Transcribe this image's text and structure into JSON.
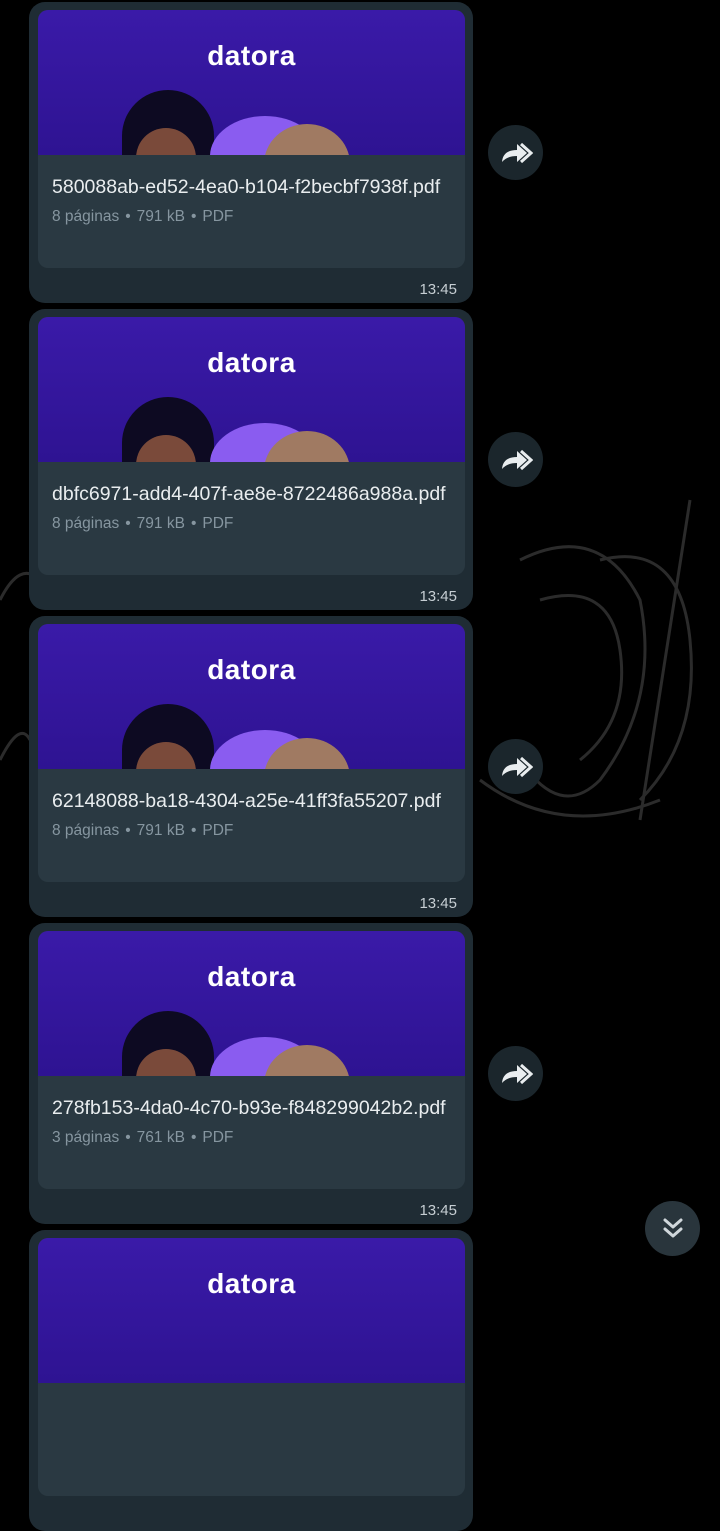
{
  "messages": [
    {
      "brand": "datora",
      "file_name": "580088ab-ed52-4ea0-b104-f2becbf7938f.pdf",
      "pages": "8 páginas",
      "size": "791 kB",
      "type": "PDF",
      "time": "13:45"
    },
    {
      "brand": "datora",
      "file_name": "dbfc6971-add4-407f-ae8e-8722486a988a.pdf",
      "pages": "8 páginas",
      "size": "791 kB",
      "type": "PDF",
      "time": "13:45"
    },
    {
      "brand": "datora",
      "file_name": "62148088-ba18-4304-a25e-41ff3fa55207.pdf",
      "pages": "8 páginas",
      "size": "791 kB",
      "type": "PDF",
      "time": "13:45"
    },
    {
      "brand": "datora",
      "file_name": "278fb153-4da0-4c70-b93e-f848299042b2.pdf",
      "pages": "3 páginas",
      "size": "761 kB",
      "type": "PDF",
      "time": "13:45"
    },
    {
      "brand": "datora"
    }
  ],
  "separator": "•",
  "icons": {
    "forward": "forward-icon",
    "scroll_down": "chevron-double-down-icon"
  },
  "colors": {
    "bubble": "#1f2c34",
    "preview": "#3a1aa8",
    "background": "#000000"
  }
}
